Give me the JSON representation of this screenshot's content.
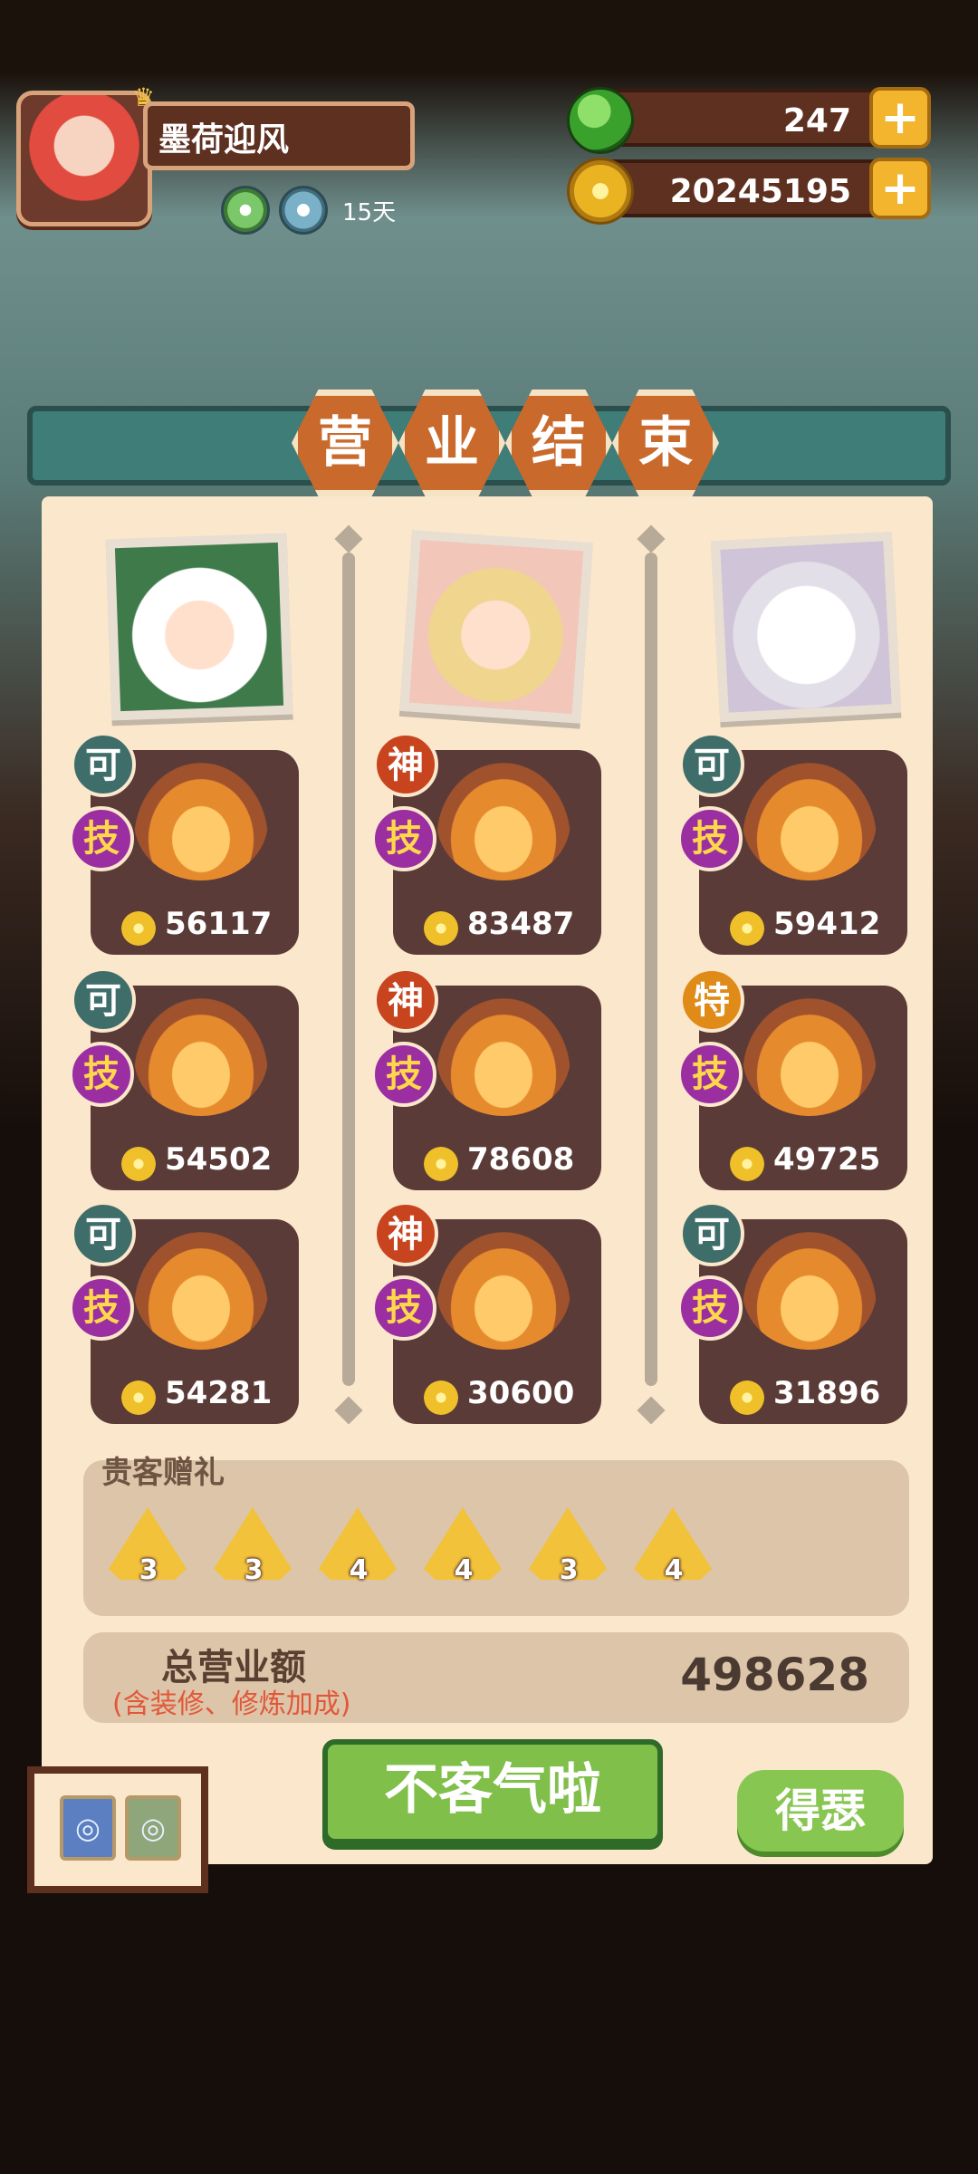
{
  "player": {
    "name": "墨荷迎风",
    "buff_days": "15天"
  },
  "currency": {
    "gems": "247",
    "coins": "20245195"
  },
  "banner": {
    "title_chars": [
      "营",
      "业",
      "结",
      "束"
    ]
  },
  "dishes": [
    {
      "grade": "可",
      "skill": "技",
      "price": "56117"
    },
    {
      "grade": "神",
      "skill": "技",
      "price": "83487"
    },
    {
      "grade": "可",
      "skill": "技",
      "price": "59412"
    },
    {
      "grade": "可",
      "skill": "技",
      "price": "54502"
    },
    {
      "grade": "神",
      "skill": "技",
      "price": "78608"
    },
    {
      "grade": "特",
      "skill": "技",
      "price": "49725"
    },
    {
      "grade": "可",
      "skill": "技",
      "price": "54281"
    },
    {
      "grade": "神",
      "skill": "技",
      "price": "30600"
    },
    {
      "grade": "可",
      "skill": "技",
      "price": "31896"
    }
  ],
  "gifts": {
    "title": "贵客赠礼",
    "counts": [
      "3",
      "3",
      "4",
      "4",
      "3",
      "4"
    ]
  },
  "total": {
    "label": "总营业额",
    "note": "(含装修、修炼加成)",
    "value": "498628"
  },
  "buttons": {
    "main": "不客气啦",
    "side": "得瑟"
  },
  "mini_buttons": {
    "left": "◎",
    "right": "◎"
  }
}
